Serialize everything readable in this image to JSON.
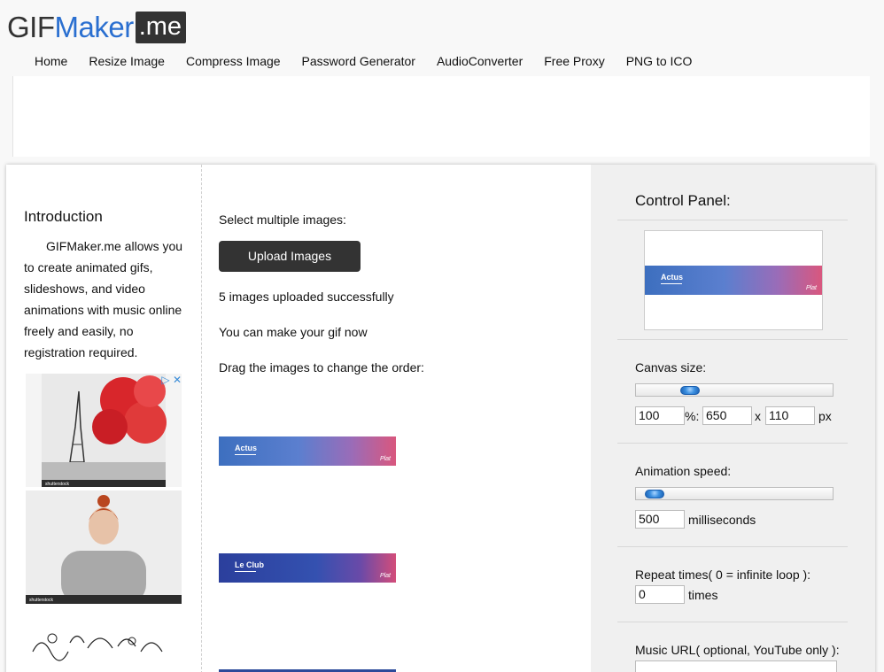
{
  "logo": {
    "part1": "GIF",
    "part2": "Maker",
    "part3": ".me"
  },
  "nav": [
    "Home",
    "Resize Image",
    "Compress Image",
    "Password Generator",
    "AudioConverter",
    "Free Proxy",
    "PNG to ICO"
  ],
  "intro": {
    "title": "Introduction",
    "text": "GIFMaker.me allows you to create animated gifs, slideshows, and video animations with music online freely and easily, no registration required."
  },
  "upload": {
    "select_label": "Select multiple images:",
    "button_label": "Upload Images",
    "status": "5 images uploaded successfully",
    "hint": "You can make your gif now",
    "drag_label": "Drag the images to change the order:"
  },
  "images": [
    {
      "title": "Actus",
      "badge": "Plat"
    },
    {
      "title": "Le Club",
      "badge": "Plat"
    }
  ],
  "panel": {
    "title": "Control Panel:",
    "preview_title": "Actus",
    "preview_badge": "Plat",
    "canvas_label": "Canvas size:",
    "canvas_percent": "100",
    "percent_unit": "%:",
    "canvas_width": "650",
    "x_sep": "x",
    "canvas_height": "110",
    "px_unit": "px",
    "speed_label": "Animation speed:",
    "speed_value": "500",
    "speed_unit": "milliseconds",
    "repeat_label": "Repeat times( 0 = infinite loop ):",
    "repeat_value": "0",
    "repeat_unit": "times",
    "music_label": "Music URL( optional, YouTube only ):"
  },
  "ads": {
    "tag": "shutterstock"
  },
  "colors": {
    "accent": "#2a6fd0",
    "dark_button": "#333333",
    "panel_bg": "#f0f0f0"
  }
}
